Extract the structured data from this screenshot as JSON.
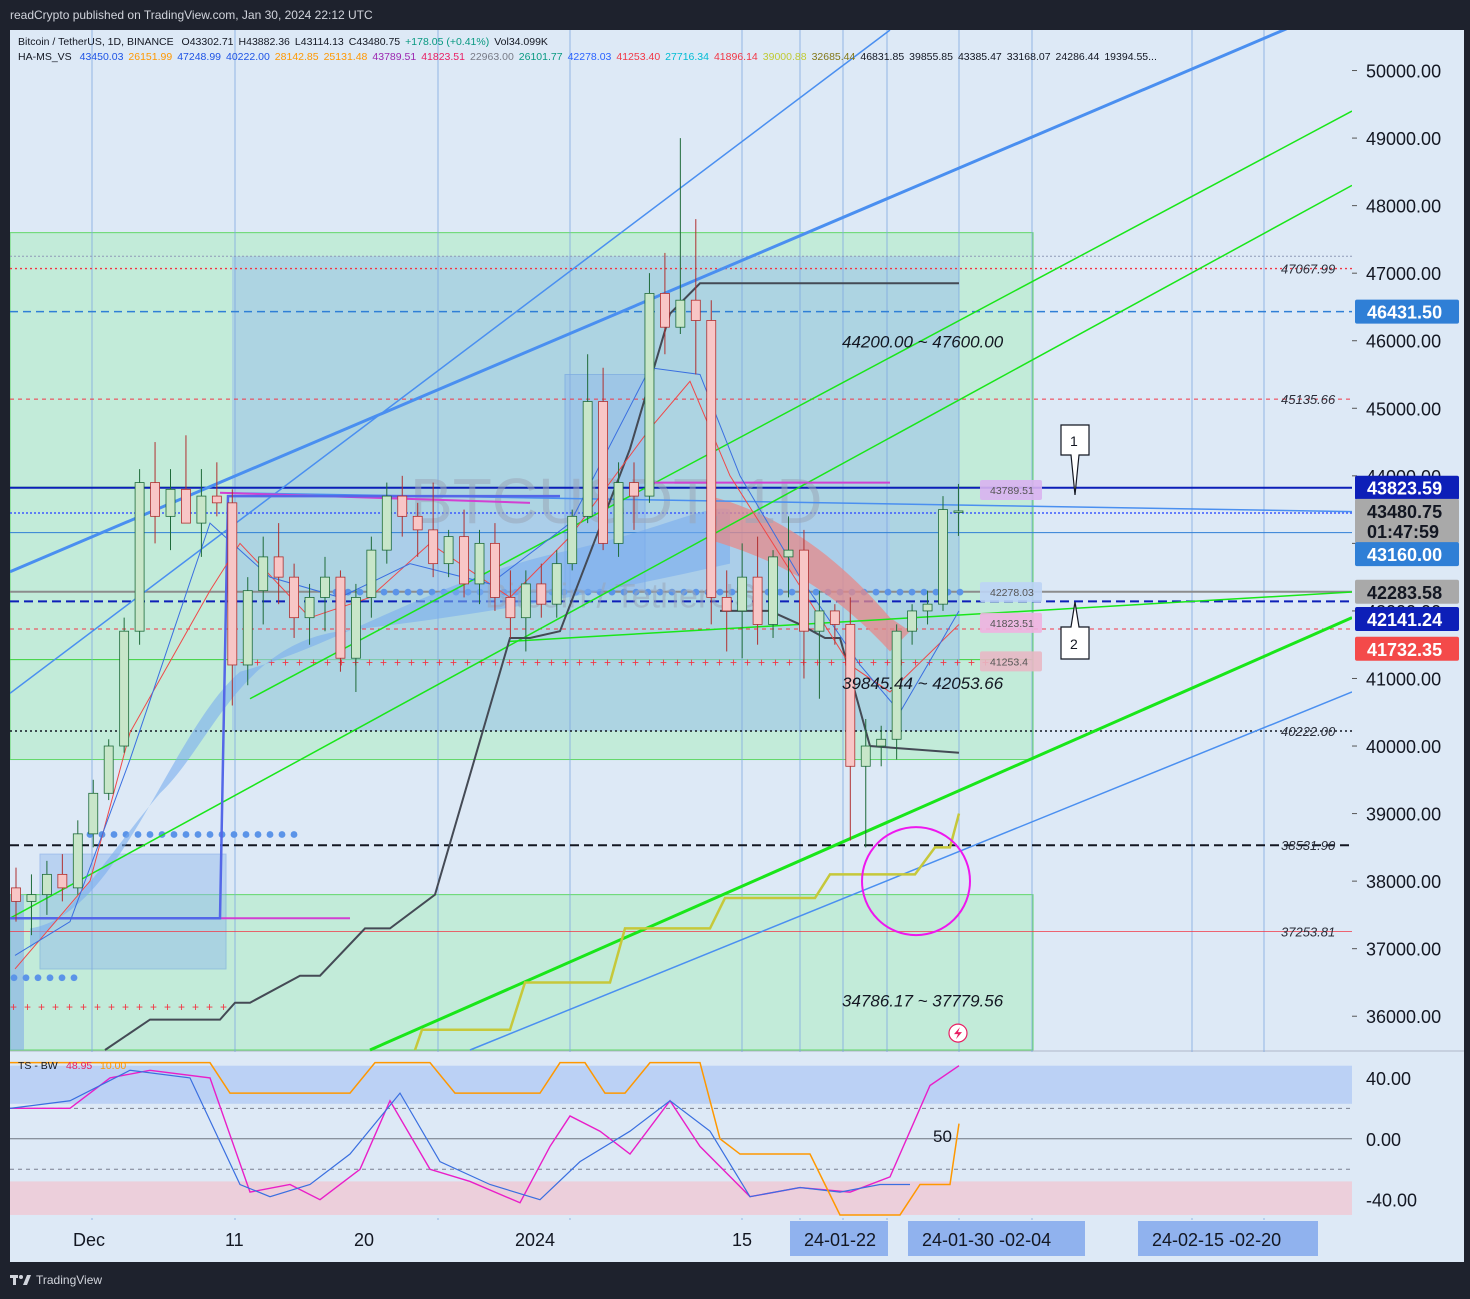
{
  "header": {
    "publisher": "readCrypto published on TradingView.com, Jan 30, 2024 22:12 UTC"
  },
  "legend": {
    "symbol_line": "Bitcoin / TetherUS, 1D, BINANCE",
    "ohlc": [
      "O43302.71",
      "H43882.36",
      "L43114.13",
      "C43480.75",
      "+178.05 (+0.41%)",
      "Vol34.099K"
    ],
    "indicator_name": "HA-MS_VS",
    "indicator_values": [
      {
        "v": "43450.03",
        "c": "#1e53e5"
      },
      {
        "v": "26151.99",
        "c": "#ff9800"
      },
      {
        "v": "47248.99",
        "c": "#1e53e5"
      },
      {
        "v": "40222.00",
        "c": "#1e53e5"
      },
      {
        "v": "28142.85",
        "c": "#ff9800"
      },
      {
        "v": "25131.48",
        "c": "#ff9800"
      },
      {
        "v": "43789.51",
        "c": "#9c27b0"
      },
      {
        "v": "41823.51",
        "c": "#e91e63"
      },
      {
        "v": "22963.00",
        "c": "#787b86"
      },
      {
        "v": "26101.77",
        "c": "#089981"
      },
      {
        "v": "42278.03",
        "c": "#2962ff"
      },
      {
        "v": "41253.40",
        "c": "#f23645"
      },
      {
        "v": "27716.34",
        "c": "#00bcd4"
      },
      {
        "v": "41896.14",
        "c": "#f23645"
      },
      {
        "v": "39000.88",
        "c": "#c0ca33"
      },
      {
        "v": "32685.44",
        "c": "#827717"
      },
      {
        "v": "46831.85",
        "c": "#131722"
      },
      {
        "v": "39855.85",
        "c": "#131722"
      },
      {
        "v": "43385.47",
        "c": "#131722"
      },
      {
        "v": "33168.07",
        "c": "#131722"
      },
      {
        "v": "24286.44",
        "c": "#131722"
      },
      {
        "v": "19394.55...",
        "c": "#131722"
      }
    ],
    "osc_name": "TS - BW",
    "osc_values": [
      {
        "v": "48.95",
        "c": "#e91e63"
      },
      {
        "v": "10.00",
        "c": "#ff9800"
      }
    ]
  },
  "watermark": {
    "symbol": "BTCUSDT, 1D",
    "description": "Bitcoin / TetherUS"
  },
  "price_scale": {
    "ticks": [
      "50000.00",
      "49000.00",
      "48000.00",
      "47000.00",
      "46000.00",
      "45000.00",
      "44000.00",
      "43000.00",
      "42000.00",
      "41000.00",
      "40000.00",
      "39000.00",
      "38000.00",
      "37000.00",
      "36000.00"
    ],
    "tick_values": [
      50000,
      49000,
      48000,
      47000,
      46000,
      45000,
      44000,
      43000,
      42000,
      41000,
      40000,
      39000,
      38000,
      37000,
      36000
    ],
    "range": [
      35500,
      50600
    ]
  },
  "price_tags": [
    {
      "label": "46431.50",
      "value": 46431.5,
      "bg": "#2f7fd6",
      "fg": "#ffffff"
    },
    {
      "label": "43823.59",
      "value": 43823.59,
      "bg": "#0d1fb8",
      "fg": "#ffffff"
    },
    {
      "label": "43480.75",
      "value": 43480.75,
      "bg": "#a9a9a9",
      "fg": "#131722"
    },
    {
      "label": "01:47:59",
      "value": 43180,
      "bg": "#a9a9a9",
      "fg": "#131722"
    },
    {
      "label": "43160.00",
      "value": 42840,
      "bg": "#2f7fd6",
      "fg": "#ffffff"
    },
    {
      "label": "42283.58",
      "value": 42283.58,
      "bg": "#a9a9a9",
      "fg": "#131722"
    },
    {
      "label": "42141.24",
      "value": 41880,
      "bg": "#0d1fb8",
      "fg": "#ffffff"
    },
    {
      "label": "41732.35",
      "value": 41440,
      "bg": "#f44a4a",
      "fg": "#ffffff"
    }
  ],
  "level_labels": [
    {
      "label": "47067.99",
      "value": 47067.99
    },
    {
      "label": "45135.66",
      "value": 45135.66
    },
    {
      "label": "40222.00",
      "value": 40222.0
    },
    {
      "label": "38531.90",
      "value": 38531.9
    },
    {
      "label": "37253.81",
      "value": 37253.81
    }
  ],
  "zone_labels": [
    {
      "label": "44200.00 ~ 47600.00",
      "value": 46000
    },
    {
      "label": "39845.44 ~ 42053.66",
      "value": 40950
    },
    {
      "label": "34786.17 ~ 37779.56",
      "value": 36250
    }
  ],
  "small_tags": [
    {
      "label": "43789.51",
      "value": 43789.51,
      "bg": "#d9b3f0"
    },
    {
      "label": "42278.03",
      "value": 42278.03,
      "bg": "#bcd4f5"
    },
    {
      "label": "41823.51",
      "value": 41823.51,
      "bg": "#f0b3e0"
    },
    {
      "label": "41253.4",
      "value": 41253.4,
      "bg": "#e8b8c4"
    }
  ],
  "callouts": [
    "1",
    "2"
  ],
  "oscillator": {
    "ticks": [
      "40.00",
      "0.00",
      "-40.00"
    ],
    "tick_values": [
      40,
      0,
      -40
    ],
    "range": [
      -52,
      57
    ],
    "level_label": "50"
  },
  "time_axis": {
    "labels": [
      "Dec",
      "11",
      "20",
      "2024",
      "15"
    ],
    "boxes": [
      "24-01-22",
      "24-01-30   -02-04",
      "24-02-15   -02-20"
    ]
  },
  "colors": {
    "background": "#dde9f6",
    "up_candle": "#c8e6c9",
    "down_candle": "#f8c6c6",
    "channel_green": "#19e619",
    "trend_blue": "#4a8ff0",
    "support_yellow": "#c6c83a",
    "circle_magenta": "#ee17ee"
  },
  "footer": {
    "brand": "TradingView"
  }
}
